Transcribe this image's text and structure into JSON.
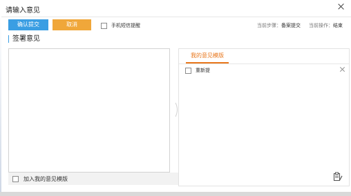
{
  "dialog": {
    "title": "请输入意见",
    "close_icon": "close-icon"
  },
  "toolbar": {
    "confirm_label": "确认提交",
    "cancel_label": "取消",
    "sms_label": "手机短信提醒",
    "current_step_label": "当前步骤：",
    "current_step_value": "备案提交",
    "current_action_label": "当前操作：",
    "current_action_value": "结束"
  },
  "section": {
    "title": "签署意见"
  },
  "left": {
    "opinion_text": "",
    "add_template_label": "加入我的意见模版"
  },
  "right": {
    "tab_label": "我的意见模版",
    "templates": [
      {
        "label": "重新提"
      }
    ],
    "manage_icon": "clipboard-edit-icon"
  },
  "colors": {
    "confirm": "#3a9ee3",
    "cancel": "#f0a73a",
    "tab_active": "#e8761b",
    "section_accent": "#3a9ee3"
  }
}
